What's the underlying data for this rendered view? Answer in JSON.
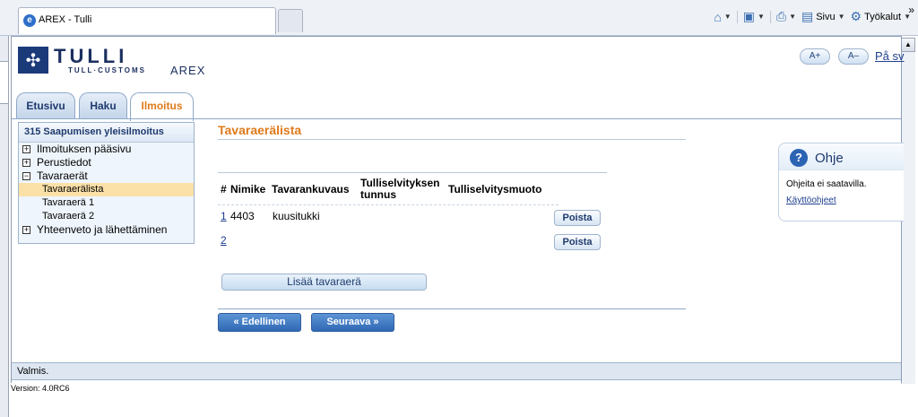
{
  "browser": {
    "tab_title": "AREX - Tulli",
    "favicon": "e",
    "tools": {
      "home": "home-icon",
      "feeds": "feed-icon",
      "print": "print-icon",
      "page_label": "Sivu",
      "tools_label": "Työkalut",
      "chevron": "»"
    }
  },
  "header": {
    "brand": "TULLI",
    "brand_sub": "TULL·CUSTOMS",
    "app_name": "AREX",
    "font_increase": "A+",
    "font_decrease": "A–",
    "lang_link": "På sv"
  },
  "tabs": [
    {
      "label": "Etusivu"
    },
    {
      "label": "Haku"
    },
    {
      "label": "Ilmoitus"
    }
  ],
  "nav": {
    "heading": "315 Saapumisen yleisilmoitus",
    "items": [
      {
        "label": "Ilmoituksen pääsivu",
        "toggle": "+"
      },
      {
        "label": "Perustiedot",
        "toggle": "+"
      },
      {
        "label": "Tavaraerät",
        "toggle": "−"
      }
    ],
    "subitems": [
      {
        "label": "Tavaraerälista"
      },
      {
        "label": "Tavaraerä 1"
      },
      {
        "label": "Tavaraerä 2"
      }
    ],
    "last_item": {
      "label": "Yhteenveto ja lähettäminen",
      "toggle": "+"
    }
  },
  "content": {
    "title": "Tavaraerälista",
    "columns": [
      "#",
      "Nimike",
      "Tavarankuvaus",
      "Tulliselvityksen tunnus",
      "Tulliselvitysmuoto"
    ],
    "rows": [
      {
        "num": "1",
        "nimike": "4403",
        "kuvaus": "kuusitukki",
        "action": "Poista"
      },
      {
        "num": "2",
        "nimike": "",
        "kuvaus": "",
        "action": "Poista"
      }
    ],
    "add_button": "Lisää tavaraerä",
    "prev_button": "«  Edellinen",
    "next_button": "Seuraava  »"
  },
  "help": {
    "title": "Ohje",
    "icon": "?",
    "text": "Ohjeita ei saatavilla.",
    "link": "Käyttöohjeet"
  },
  "status": "Valmis.",
  "version": "Version: 4.0RC6"
}
